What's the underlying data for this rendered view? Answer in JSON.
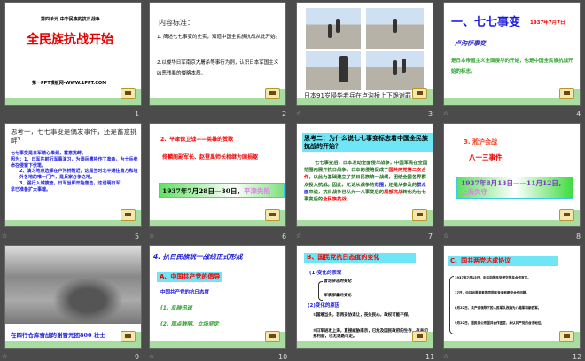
{
  "slides": [
    {
      "num": "1",
      "subtitle": "第四单元 中华民族的抗日战争",
      "title": "全民族抗战开始",
      "footer": "第一PPT模板网-WWW.1PPT.COM"
    },
    {
      "num": "2",
      "heading": "内容标准：",
      "items": [
        "1. 简述七七事变的史实，知道中国全民族抗战从此开始。",
        "2.以侵华日军南京大屠杀等事行为例，认识日本军国主义凶恶残暴的侵略本质。"
      ]
    },
    {
      "num": "3",
      "caption": "日本91岁侵华老兵在卢沟桥上下跪谢罪"
    },
    {
      "num": "4",
      "title": "一、七七事变",
      "date": "1937年7月7日",
      "sub": "卢沟桥事变",
      "body": "是日本帝国主义全面侵华的开始，也是中国全民族抗战开始的标志。"
    },
    {
      "num": "5",
      "heading": "思考一，七七事变是偶发事件，还是蓄意挑衅？",
      "bullets": [
        "七七事变是日军精心策划，蓄意挑衅。",
        "因为：1、日军先前行军事演习，为调兵遣将作了准备，为士兵卖命在侵窗下伏笔。",
        "2、演习地点选择在卢沟桥附近，这是当时北平通往南方和境外各地的唯一门户，是兵家必争之地。",
        "3、强行入城搜查，日军当即开始轰击，这说明日军",
        "早已准备扩大事端。"
      ]
    },
    {
      "num": "6",
      "title": "2、平津保卫战——英雄的赞歌",
      "body": "佟麟阁副军长、赵登禹师长相继为国捐躯",
      "date": "1937年7月28日—30日，",
      "fall": "平津失陷"
    },
    {
      "num": "7",
      "heading": "思考二：为什么说七七事变标志着中国全民族抗战的开始？",
      "body": [
        "七七事变后，日本发动全面侵华战争，中国军民在全国范围内展开抗日战争。日本的侵略促成了",
        "国共两党第二次合作",
        "，以此为基础建立了抗日民族统一战线，团结全国各界群众投入抗战。因此，无论从战争的",
        "范围",
        "，还是从参及的",
        "群众面",
        "来说，抗日战争已从九一八事变后的",
        "局部抗战",
        "转化为七七事变后的",
        "全民族抗战",
        "。"
      ]
    },
    {
      "num": "8",
      "title": "3. 淞沪会战",
      "sub": "八一三事件",
      "date": "1937年8月13日——11月12日，",
      "fall": "上海失守"
    },
    {
      "num": "9",
      "caption": "在四行仓库奋战的谢晋元团800 壮士"
    },
    {
      "num": "10",
      "title": "4. 抗日民族统一战线正式形成",
      "sectionA": "A、中国共产党的倡导",
      "sub": "中国共产党的抗日态度",
      "items": [
        "(1) 反映迅速",
        "(2) 观点鲜明、立场坚定"
      ]
    },
    {
      "num": "11",
      "title": "B、国民党抗日态度的变化",
      "p1": "(1)变化的表现",
      "b1": [
        "言论杂志的变化",
        "军事部署的变化"
      ],
      "p2": "(2)变化的原因",
      "b2": [
        "①国难当头，若再妥协退让，丧失民心，政权可能不保。",
        "②日军进攻上海，直接威胁南京，已危及国民政府的生存，有关切身利益，已无退路可走。"
      ]
    },
    {
      "num": "12",
      "title": "C、国共两党达成协议",
      "items": [
        "1937年7月15日，中共向国民党送交国共合作宣言。",
        "17日，中共派周恩来等同国民党谈判两党合作问题。",
        "8月22日，共产党领导下的人民军队改编为八路军和新四军。",
        "9月22日，国民党公布国共合作宣言，承认共产党的合法地位。"
      ]
    }
  ]
}
